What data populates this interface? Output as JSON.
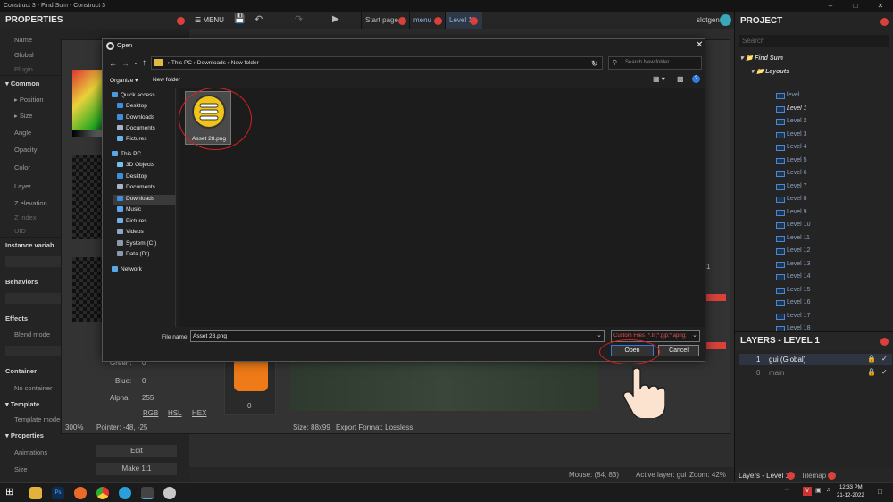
{
  "window": {
    "title": "Construct 3 - Find Sum - Construct 3"
  },
  "topbar": {
    "menu_label": "MENU",
    "tabs": [
      "Start page",
      "menu",
      "Level 1"
    ],
    "username": "slotgen"
  },
  "properties": {
    "header": "PROPERTIES",
    "rows": [
      {
        "label": "Name",
        "value": "m..."
      },
      {
        "label": "Global",
        "value": ""
      },
      {
        "label": "Plugin",
        "value": ""
      },
      {
        "label": "Common",
        "section": true
      },
      {
        "label": "Position",
        "value": ""
      },
      {
        "label": "Size",
        "value": ""
      },
      {
        "label": "Angle",
        "value": ""
      },
      {
        "label": "Opacity",
        "value": ""
      },
      {
        "label": "Color",
        "value": ""
      },
      {
        "label": "Layer",
        "value": ""
      },
      {
        "label": "Z elevation",
        "value": ""
      },
      {
        "label": "Z index",
        "value": ""
      },
      {
        "label": "UID",
        "value": ""
      },
      {
        "label": "Instance variab",
        "section": true
      },
      {
        "label": "Behaviors",
        "section": true
      },
      {
        "label": "Effects",
        "section": true
      },
      {
        "label": "Blend mode",
        "value": ""
      },
      {
        "label": "Container",
        "section": true
      },
      {
        "label": "No container",
        "value": ""
      },
      {
        "label": "Template",
        "section": true
      },
      {
        "label": "Template mode",
        "value": ""
      },
      {
        "label": "Properties",
        "section": true
      },
      {
        "label": "Animations",
        "value": "Edit"
      },
      {
        "label": "Size",
        "value": "Make 1:1"
      }
    ]
  },
  "image_editor": {
    "color_fields": [
      {
        "label": "Green:",
        "value": "0"
      },
      {
        "label": "Blue:",
        "value": "0"
      },
      {
        "label": "Alpha:",
        "value": "255"
      }
    ],
    "modes": [
      "RGB",
      "HSL",
      "HEX"
    ],
    "zoom": "300%",
    "pointer": "Pointer: -48, -25",
    "size": "Size: 88x99",
    "export_format": "Export Format: Lossless",
    "frame_index": "0",
    "anim_index": "1"
  },
  "statusbar": {
    "mouse": "Mouse: (84, 83)",
    "active_layer": "Active layer: gui",
    "zoom": "Zoom: 42%"
  },
  "project": {
    "header": "PROJECT",
    "search_placeholder": "Search",
    "root": "Find Sum",
    "layouts_folder": "Layouts",
    "layouts": [
      "level",
      "Level 1",
      "Level 2",
      "Level 3",
      "Level 4",
      "Level 5",
      "Level 6",
      "Level 7",
      "Level 8",
      "Level 9",
      "Level 10",
      "Level 11",
      "Level 12",
      "Level 13",
      "Level 14",
      "Level 15",
      "Level 16",
      "Level 17",
      "Level 18",
      "Level 19"
    ]
  },
  "layers": {
    "header": "LAYERS - LEVEL 1",
    "items": [
      {
        "index": "1",
        "name": "gui (Global)"
      },
      {
        "index": "0",
        "name": "main"
      }
    ],
    "bottom_tabs": [
      "Layers - Level 1",
      "Tilemap"
    ]
  },
  "dialog": {
    "title": "Open",
    "breadcrumb": [
      "This PC",
      "Downloads",
      "New folder"
    ],
    "search_placeholder": "Search New folder",
    "toolbar": {
      "organize": "Organize",
      "new_folder": "New folder"
    },
    "nav": [
      {
        "label": "Quick access",
        "icon": "star-icon",
        "color": "#4a9be0",
        "indent": 0
      },
      {
        "label": "Desktop",
        "icon": "desktop-icon",
        "color": "#3d8ee0",
        "indent": 1
      },
      {
        "label": "Downloads",
        "icon": "download-icon",
        "color": "#3d8ee0",
        "indent": 1
      },
      {
        "label": "Documents",
        "icon": "document-icon",
        "color": "#a5b4c8",
        "indent": 1
      },
      {
        "label": "Pictures",
        "icon": "picture-icon",
        "color": "#6fb0e8",
        "indent": 1
      },
      {
        "label": "This PC",
        "icon": "computer-icon",
        "color": "#5aa6e8",
        "indent": 0
      },
      {
        "label": "3D Objects",
        "icon": "cube-icon",
        "color": "#6fc3f0",
        "indent": 1
      },
      {
        "label": "Desktop",
        "icon": "desktop-icon",
        "color": "#3d8ee0",
        "indent": 1
      },
      {
        "label": "Documents",
        "icon": "document-icon",
        "color": "#a5b4c8",
        "indent": 1
      },
      {
        "label": "Downloads",
        "icon": "download-icon",
        "color": "#3d8ee0",
        "indent": 1
      },
      {
        "label": "Music",
        "icon": "music-icon",
        "color": "#5aa6e8",
        "indent": 1
      },
      {
        "label": "Pictures",
        "icon": "picture-icon",
        "color": "#6fb0e8",
        "indent": 1
      },
      {
        "label": "Videos",
        "icon": "video-icon",
        "color": "#8ea7c4",
        "indent": 1
      },
      {
        "label": "System (C:)",
        "icon": "drive-icon",
        "color": "#8a9aac",
        "indent": 1
      },
      {
        "label": "Data (D:)",
        "icon": "drive-icon",
        "color": "#8a9aac",
        "indent": 1
      },
      {
        "label": "Network",
        "icon": "network-icon",
        "color": "#5aa6e8",
        "indent": 0
      }
    ],
    "file": {
      "name": "Asset 28.png"
    },
    "filename_label": "File name:",
    "filename_value": "Asset 28.png",
    "filter": "Custom Files (*.tif;*.pjp;*.apng;",
    "open_label": "Open",
    "cancel_label": "Cancel"
  },
  "taskbar": {
    "time": "12:33 PM",
    "date": "21-12-2022"
  }
}
